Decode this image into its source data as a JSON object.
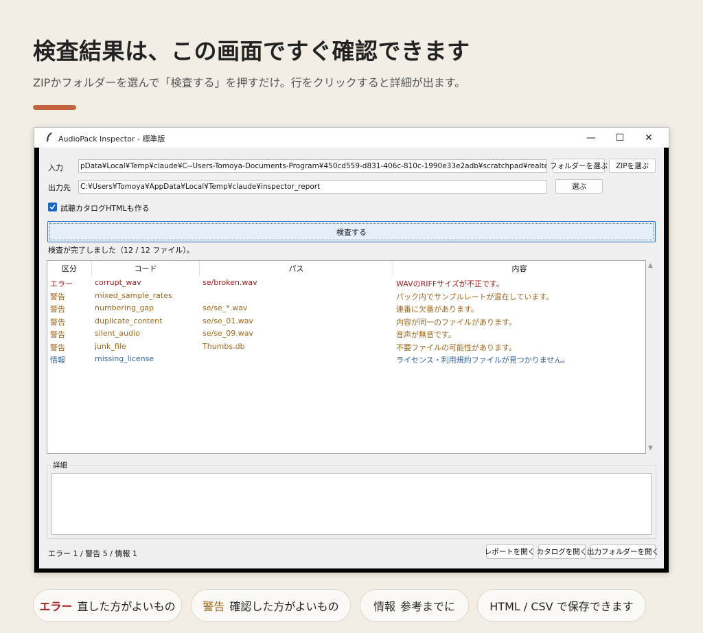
{
  "hero": {
    "title": "検査結果は、この画面ですぐ確認できます",
    "subtitle": "ZIPかフォルダーを選んで「検査する」を押すだけ。行をクリックすると詳細が出ます。"
  },
  "window": {
    "title": "AudioPack Inspector - 標準版",
    "controls": {
      "minimize": "—",
      "maximize": "☐",
      "close": "✕"
    }
  },
  "form": {
    "input_label": "入力",
    "input_value": "pData¥Local¥Temp¥claude¥C--Users-Tomoya-Documents-Program¥450cd559-d831-406c-810c-1990e33e2adb¥scratchpad¥realtest¥pack.zip",
    "folder_button": "フォルダーを選ぶ",
    "zip_button": "ZIPを選ぶ",
    "output_label": "出力先",
    "output_value": "C:¥Users¥Tomoya¥AppData¥Local¥Temp¥claude¥inspector_report",
    "output_button": "選ぶ",
    "catalog_checkbox_label": "試聴カタログHTMLも作る",
    "catalog_checked": true,
    "inspect_button": "検査する",
    "status_message": "検査が完了しました（12 / 12 ファイル）。"
  },
  "table": {
    "columns": [
      "区分",
      "コード",
      "パス",
      "内容"
    ],
    "rows": [
      {
        "kind": "エラー",
        "code": "corrupt_wav",
        "path": "se/broken.wav",
        "desc": "WAVのRIFFサイズが不正です。",
        "level": "error"
      },
      {
        "kind": "警告",
        "code": "mixed_sample_rates",
        "path": "",
        "desc": "パック内でサンプルレートが混在しています。",
        "level": "warn"
      },
      {
        "kind": "警告",
        "code": "numbering_gap",
        "path": "se/se_*.wav",
        "desc": "連番に欠番があります。",
        "level": "warn"
      },
      {
        "kind": "警告",
        "code": "duplicate_content",
        "path": "se/se_01.wav",
        "desc": "内容が同一のファイルがあります。",
        "level": "warn"
      },
      {
        "kind": "警告",
        "code": "silent_audio",
        "path": "se/se_09.wav",
        "desc": "音声が無音です。",
        "level": "warn"
      },
      {
        "kind": "警告",
        "code": "junk_file",
        "path": "Thumbs.db",
        "desc": "不要ファイルの可能性があります。",
        "level": "warn"
      },
      {
        "kind": "情報",
        "code": "missing_license",
        "path": "",
        "desc": "ライセンス・利用規約ファイルが見つかりません。",
        "level": "info"
      }
    ]
  },
  "detail": {
    "label": "詳細"
  },
  "footer": {
    "summary": "エラー 1 / 警告 5 / 情報 1",
    "open_report": "レポートを開く",
    "open_catalog": "カタログを開く",
    "open_output_folder": "出力フォルダーを開く"
  },
  "legend": {
    "error_tag": "エラー",
    "error_text": "直した方がよいもの",
    "warn_tag": "警告",
    "warn_text": "確認した方がよいもの",
    "info_tag": "情報",
    "info_text": "参考までに",
    "export_text": "HTML / CSV で保存できます"
  },
  "colors": {
    "error": "#a01c1c",
    "warn": "#a0671c",
    "info": "#34669e",
    "accent": "#c4643f",
    "button_focus": "#1e6fc4"
  }
}
